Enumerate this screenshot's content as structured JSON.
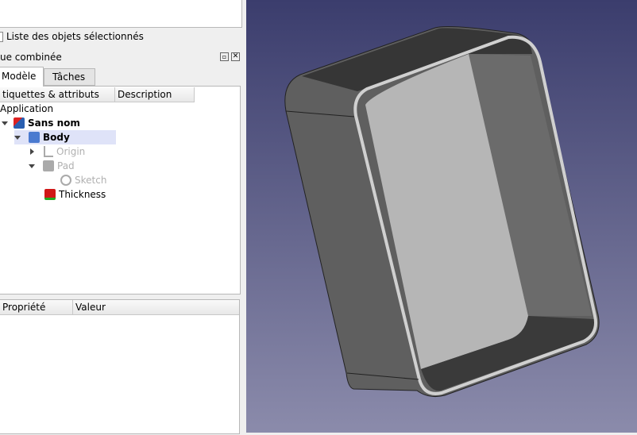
{
  "selection": {
    "checkbox_label": "Liste des objets sélectionnés",
    "checked": false
  },
  "combo": {
    "title": "ue combinée",
    "tabs": [
      {
        "label": "Modèle",
        "active": true
      },
      {
        "label": "Tâches",
        "active": false
      }
    ]
  },
  "tree": {
    "columns": [
      "tiquettes & attributs",
      "Description"
    ],
    "root": "Application",
    "items": [
      {
        "label": "Sans nom",
        "bold": true,
        "icon": "document-icon"
      },
      {
        "label": "Body",
        "bold": true,
        "icon": "body-icon",
        "selected": true
      },
      {
        "label": "Origin",
        "icon": "origin-icon",
        "hidden": true
      },
      {
        "label": "Pad",
        "icon": "pad-icon",
        "hidden": true
      },
      {
        "label": "Sketch",
        "icon": "sketch-icon",
        "hidden": true
      },
      {
        "label": "Thickness",
        "icon": "thickness-icon"
      }
    ]
  },
  "properties": {
    "columns": [
      "Propriété",
      "Valeur"
    ]
  }
}
